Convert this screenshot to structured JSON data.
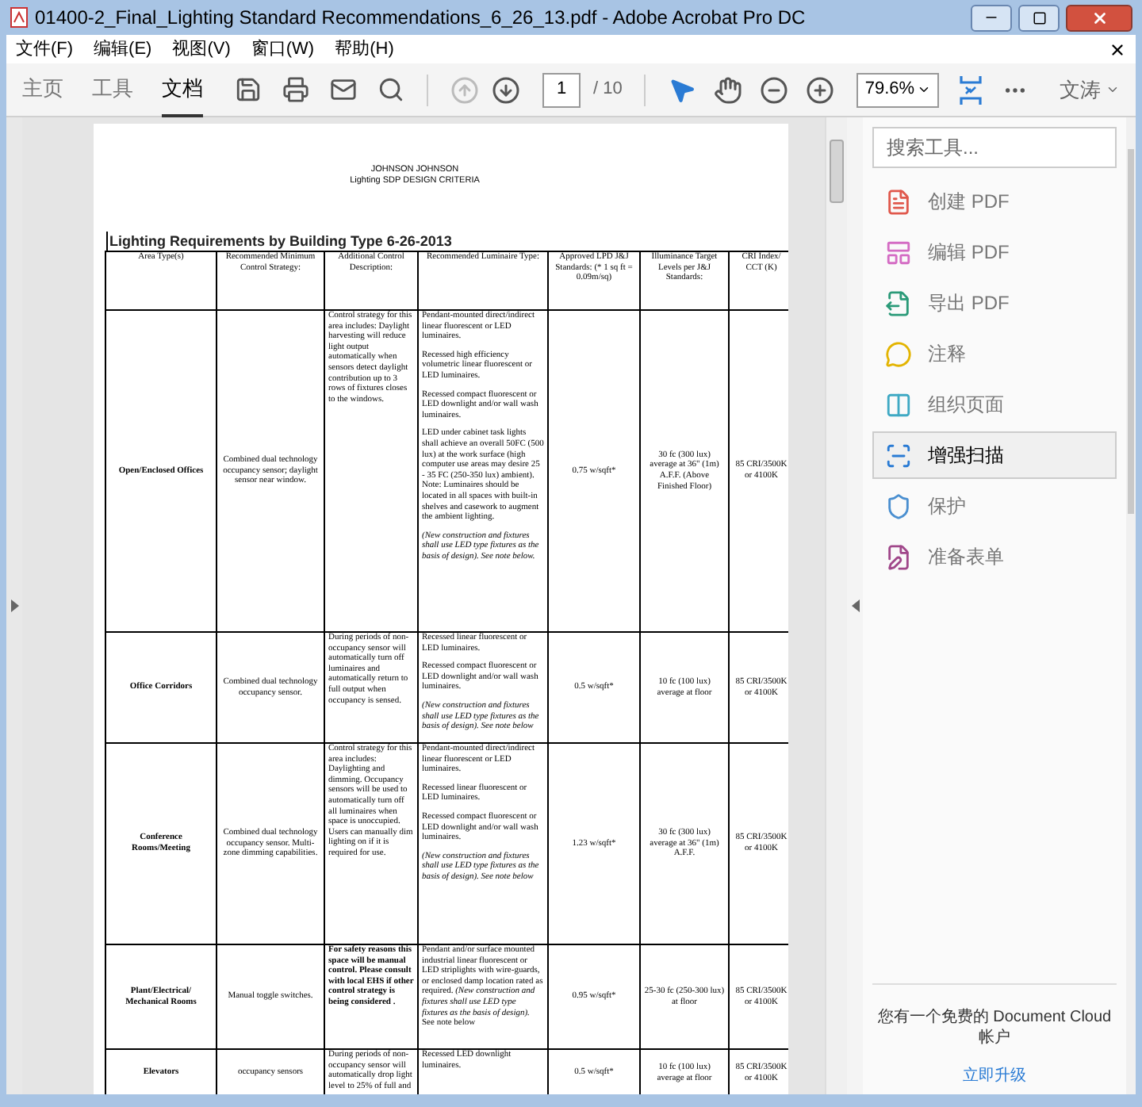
{
  "window": {
    "title": "01400-2_Final_Lighting Standard Recommendations_6_26_13.pdf - Adobe Acrobat Pro DC"
  },
  "menu": [
    "文件(F)",
    "编辑(E)",
    "视图(V)",
    "窗口(W)",
    "帮助(H)"
  ],
  "toolbar": {
    "tabs": [
      {
        "label": "主页",
        "selected": false
      },
      {
        "label": "工具",
        "selected": false
      },
      {
        "label": "文档",
        "selected": true
      }
    ],
    "nav": [
      {
        "kind": "prev",
        "disabled": true
      },
      {
        "kind": "next",
        "disabled": false
      }
    ],
    "page": {
      "value": "1",
      "total": "/ 10"
    },
    "tools": [
      {
        "kind": "select",
        "selected": true
      },
      {
        "kind": "hand",
        "selected": false
      }
    ],
    "zoom": {
      "value": "79.6%"
    },
    "user": "文涛"
  },
  "document": {
    "header": [
      "JOHNSON JOHNSON",
      "Lighting SDP DESIGN CRITERIA"
    ],
    "table": {
      "title": "Lighting Requirements by Building Type 6-26-2013",
      "columns": [
        "Area Type(s)",
        "Recommended Minimum Control Strategy:",
        "Additional Control Description:",
        "Recommended Luminaire Type:",
        "Approved LPD J&J Standards: (* 1 sq ft = 0.09m/sq)",
        "Illuminance Target Levels per J&J Standards:",
        "CRI Index/ CCT (K)"
      ],
      "rows": [
        {
          "area": "Open/Enclosed Offices",
          "strategy": "Combined dual technology occupancy sensor; daylight sensor near window.",
          "description": "Control strategy for this area includes: Daylight harvesting will reduce light output automatically when sensors detect daylight contribution up to 3 rows of fixtures closes to the windows.",
          "bold_description": false,
          "luminaire": [
            {
              "text": "Pendant-mounted direct/indirect linear fluorescent or LED luminaires.",
              "italic": false
            },
            {
              "text": "Recessed high efficiency volumetric linear fluorescent or LED luminaires.",
              "italic": false
            },
            {
              "text": "Recessed compact fluorescent or LED downlight and/or wall wash luminaires.",
              "italic": false
            },
            {
              "text": "LED under cabinet task lights shall achieve an overall 50FC (500 lux) at the work surface (high computer use areas may desire 25 - 35 FC (250-350 lux) ambient). Note: Luminaires should be located in all spaces with built-in shelves and casework to augment the ambient lighting.",
              "italic": false
            },
            {
              "text": "(New construction and fixtures shall use LED type fixtures as the basis of design). See note below.",
              "italic": true
            }
          ],
          "lpd": "0.75 w/sqft*",
          "illuminance": "30 fc (300 lux) average at 36\" (1m) A.F.F. (Above Finished Floor)",
          "cri": "85 CRI/3500K or 4100K"
        },
        {
          "area": "Office Corridors",
          "strategy": "Combined dual technology occupancy sensor.",
          "description": "During periods of non-occupancy sensor will automatically turn off luminaires and automatically return to full output when occupancy is sensed.",
          "bold_description": false,
          "luminaire": [
            {
              "text": "Recessed linear fluorescent or LED luminaires.",
              "italic": false
            },
            {
              "text": "Recessed compact fluorescent or LED downlight and/or wall wash luminaires.",
              "italic": false
            },
            {
              "text": "(New construction and fixtures shall use LED type fixtures as the basis of design). See note below",
              "italic": true
            }
          ],
          "lpd": "0.5 w/sqft*",
          "illuminance": "10 fc (100 lux) average at floor",
          "cri": "85 CRI/3500K or 4100K"
        },
        {
          "area": "Conference Rooms/Meeting",
          "strategy": "Combined dual technology occupancy sensor. Multi-zone dimming capabilities.",
          "description": "Control strategy for this area includes: Daylighting and dimming. Occupancy sensors will be used to automatically turn off all luminaires when space is unoccupied. Users can manually dim lighting on if it is required for use.",
          "bold_description": false,
          "luminaire": [
            {
              "text": "Pendant-mounted direct/indirect linear fluorescent or LED luminaires.",
              "italic": false
            },
            {
              "text": "Recessed linear fluorescent or LED luminaires.",
              "italic": false
            },
            {
              "text": "Recessed compact fluorescent or LED downlight and/or wall wash luminaires.",
              "italic": false
            },
            {
              "text": "(New construction and fixtures shall use LED type fixtures as the basis of design). See note below",
              "italic": true
            }
          ],
          "lpd": "1.23 w/sqft*",
          "illuminance": "30 fc (300 lux) average at 36\" (1m) A.F.F.",
          "cri": "85 CRI/3500K or 4100K"
        },
        {
          "area": "Plant/Electrical/ Mechanical Rooms",
          "strategy": "Manual toggle switches.",
          "description": "For safety reasons this space will be manual control. Please consult with local EHS if other control strategy is being considered .",
          "bold_description": true,
          "luminaire": [
            {
              "text": "Pendant and/or surface mounted industrial linear fluorescent or LED striplights with wire-guards, or enclosed damp location rated as required. *(New construction and fixtures shall use LED type fixtures as the basis of design).* See note below",
              "italic": false
            }
          ],
          "lpd": "0.95 w/sqft*",
          "illuminance": "25-30 fc (250-300 lux) at floor",
          "cri": "85 CRI/3500K or 4100K"
        },
        {
          "area": "Elevators",
          "strategy": "occupancy sensors",
          "description": "During periods of non-occupancy sensor will automatically drop light level to 25% of full and",
          "bold_description": false,
          "luminaire": [
            {
              "text": "Recessed LED downlight luminaires.",
              "italic": false
            }
          ],
          "lpd": "0.5 w/sqft*",
          "illuminance": "10 fc (100 lux) average at floor",
          "cri": "85 CRI/3500K or 4100K"
        }
      ]
    }
  },
  "tools_panel": {
    "search": {
      "placeholder": "搜索工具..."
    },
    "items": [
      {
        "kind": "create",
        "label": "创建 PDF",
        "selected": false
      },
      {
        "kind": "edit",
        "label": "编辑 PDF",
        "selected": false
      },
      {
        "kind": "export",
        "label": "导出 PDF",
        "selected": false
      },
      {
        "kind": "comment",
        "label": "注释",
        "selected": false
      },
      {
        "kind": "organize",
        "label": "组织页面",
        "selected": false
      },
      {
        "kind": "scan",
        "label": "增强扫描",
        "selected": true
      },
      {
        "kind": "protect",
        "label": "保护",
        "selected": false
      },
      {
        "kind": "forms",
        "label": "准备表单",
        "selected": false
      }
    ],
    "footer": {
      "text": "您有一个免费的 Document Cloud 帐户",
      "link": "立即升级"
    }
  }
}
